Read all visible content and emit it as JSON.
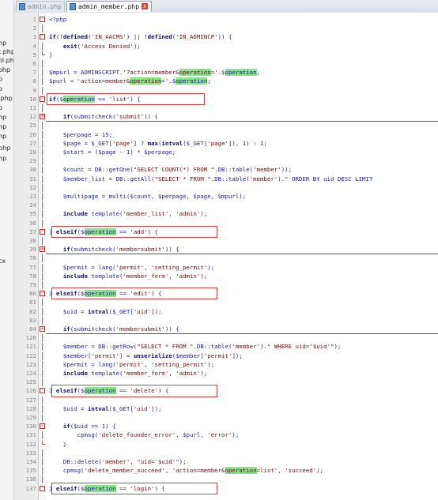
{
  "file_panel": {
    "items": [
      "hp",
      "t.php",
      "ol.ph",
      "ohp",
      "p",
      "o",
      ".php",
      "o",
      "hp",
      "hp",
      "hp",
      "php",
      "hp",
      "cx"
    ]
  },
  "tabs": [
    {
      "label": "admin.php",
      "active": false
    },
    {
      "label": "admin_member.php",
      "active": true
    }
  ],
  "colors": {
    "highlight": "#8ae28a",
    "annotation_box": "#e03a3a",
    "code_text": "#1f1f9e"
  },
  "code_lines": [
    {
      "n": "1",
      "text": "<?php"
    },
    {
      "n": "2",
      "text": ""
    },
    {
      "n": "3",
      "text": "if(!defined('IN_AACMS') || !defined('IN_ADMINCP')) {"
    },
    {
      "n": "4",
      "text": "    exit('Access Denied');"
    },
    {
      "n": "5",
      "text": "}"
    },
    {
      "n": "6",
      "text": ""
    },
    {
      "n": "7",
      "text": "$mpurl = ADMINSCRIPT.'?action=member&operation='.$operation;"
    },
    {
      "n": "8",
      "text": "$purl = 'action=member&operation='.$operation;"
    },
    {
      "n": "9",
      "text": ""
    },
    {
      "n": "10",
      "text": "if($operation == 'list') {"
    },
    {
      "n": "11",
      "text": ""
    },
    {
      "n": "12",
      "text": "    if(submitcheck('submit')) {"
    },
    {
      "n": "25",
      "text": ""
    },
    {
      "n": "26",
      "text": "    $perpage = 15;"
    },
    {
      "n": "27",
      "text": "    $page = $_GET['page'] ? max(intval($_GET['page']), 1) : 1;"
    },
    {
      "n": "28",
      "text": "    $start = ($page - 1) * $perpage;"
    },
    {
      "n": "29",
      "text": ""
    },
    {
      "n": "30",
      "text": "    $count = DB::getOne(\"SELECT COUNT(*) FROM \".DB::table('member'));"
    },
    {
      "n": "31",
      "text": "    $member_list = DB::getAll(\"SELECT * FROM \".DB::table('member').\" ORDER BY uid DESC LIMIT"
    },
    {
      "n": "32",
      "text": ""
    },
    {
      "n": "33",
      "text": "    $multipage = multi($count, $perpage, $page, $mpurl);"
    },
    {
      "n": "34",
      "text": ""
    },
    {
      "n": "35",
      "text": "    include template('member_list', 'admin');"
    },
    {
      "n": "36",
      "text": ""
    },
    {
      "n": "37",
      "text": "} elseif($operation == 'add') {"
    },
    {
      "n": "38",
      "text": ""
    },
    {
      "n": "39",
      "text": "    if(submitcheck('membersubmit')) {"
    },
    {
      "n": "76",
      "text": ""
    },
    {
      "n": "77",
      "text": "    $permit = lang('permit', 'setting_permit');"
    },
    {
      "n": "78",
      "text": "    include template('member_form', 'admin');"
    },
    {
      "n": "79",
      "text": ""
    },
    {
      "n": "80",
      "text": "} elseif($operation == 'edit') {"
    },
    {
      "n": "81",
      "text": ""
    },
    {
      "n": "82",
      "text": "    $uid = intval($_GET['uid']);"
    },
    {
      "n": "83",
      "text": ""
    },
    {
      "n": "84",
      "text": "    if(submitcheck('membersubmit')) {"
    },
    {
      "n": "120",
      "text": ""
    },
    {
      "n": "121",
      "text": "    $member = DB::getRow(\"SELECT * FROM \".DB::table('member').\" WHERE uid='$uid'\");"
    },
    {
      "n": "122",
      "text": "    $member['permit'] = unserialize($member['permit']);"
    },
    {
      "n": "123",
      "text": "    $permit = lang('permit', 'setting_permit');"
    },
    {
      "n": "124",
      "text": "    include template('member_form', 'admin');"
    },
    {
      "n": "125",
      "text": ""
    },
    {
      "n": "126",
      "text": "} elseif($operation == 'delete') {"
    },
    {
      "n": "127",
      "text": ""
    },
    {
      "n": "128",
      "text": "    $uid = intval($_GET['uid']);"
    },
    {
      "n": "129",
      "text": ""
    },
    {
      "n": "130",
      "text": "    if($uid == 1) {"
    },
    {
      "n": "131",
      "text": "        cpmsg('delete_founder_error', $purl, 'error');"
    },
    {
      "n": "132",
      "text": "    }"
    },
    {
      "n": "133",
      "text": ""
    },
    {
      "n": "134",
      "text": "    DB::delete('member', \"uid='$uid'\");"
    },
    {
      "n": "135",
      "text": "    cpmsg('delete_member_succeed', 'action=member&operation=list', 'succeed');"
    },
    {
      "n": "136",
      "text": ""
    },
    {
      "n": "137",
      "text": "} elseif($operation == 'login') {"
    }
  ]
}
